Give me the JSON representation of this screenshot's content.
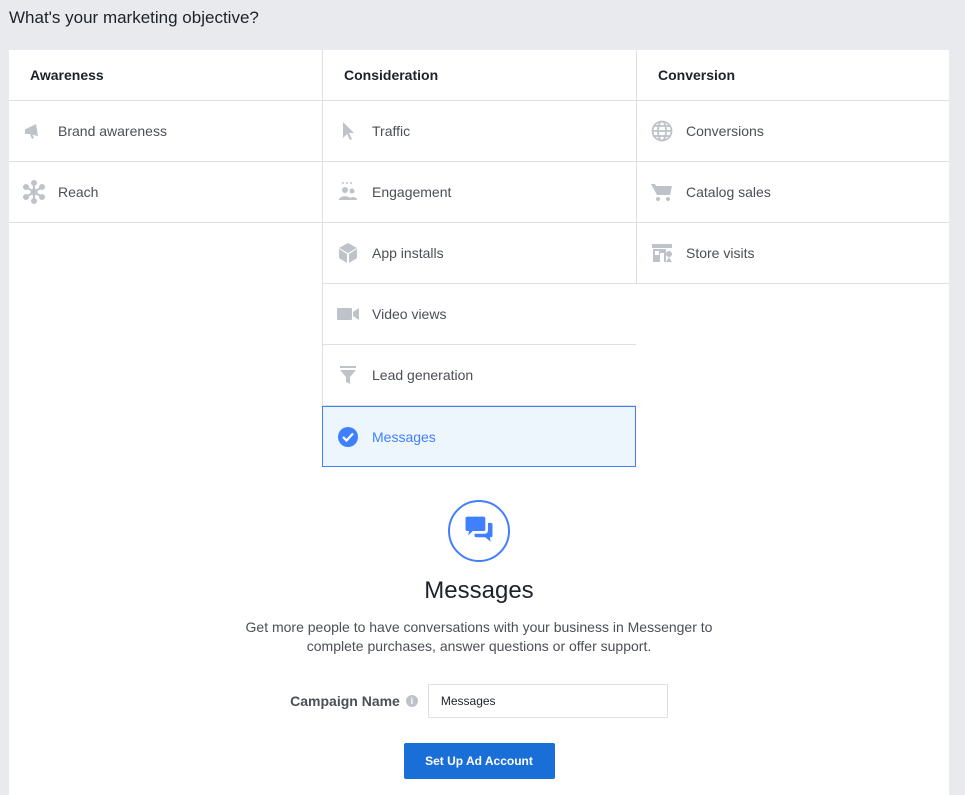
{
  "page_title": "What's your marketing objective?",
  "columns": [
    {
      "header": "Awareness",
      "items": [
        {
          "label": "Brand awareness",
          "icon": "megaphone-icon"
        },
        {
          "label": "Reach",
          "icon": "reach-icon"
        }
      ]
    },
    {
      "header": "Consideration",
      "items": [
        {
          "label": "Traffic",
          "icon": "cursor-icon"
        },
        {
          "label": "Engagement",
          "icon": "people-icon"
        },
        {
          "label": "App installs",
          "icon": "box-icon"
        },
        {
          "label": "Video views",
          "icon": "video-camera-icon"
        },
        {
          "label": "Lead generation",
          "icon": "funnel-icon"
        },
        {
          "label": "Messages",
          "icon": "check-circle-icon",
          "selected": true
        }
      ]
    },
    {
      "header": "Conversion",
      "items": [
        {
          "label": "Conversions",
          "icon": "globe-icon"
        },
        {
          "label": "Catalog sales",
          "icon": "cart-icon"
        },
        {
          "label": "Store visits",
          "icon": "store-icon"
        }
      ]
    }
  ],
  "detail": {
    "icon": "chat-bubbles-icon",
    "title": "Messages",
    "description": "Get more people to have conversations with your business in Messenger to complete purchases, answer questions or offer support."
  },
  "campaign": {
    "label": "Campaign Name",
    "value": "Messages"
  },
  "setup_button": "Set Up Ad Account",
  "colors": {
    "accent": "#4080ff",
    "button": "#1a6ed8",
    "icon": "#bec3c9"
  }
}
